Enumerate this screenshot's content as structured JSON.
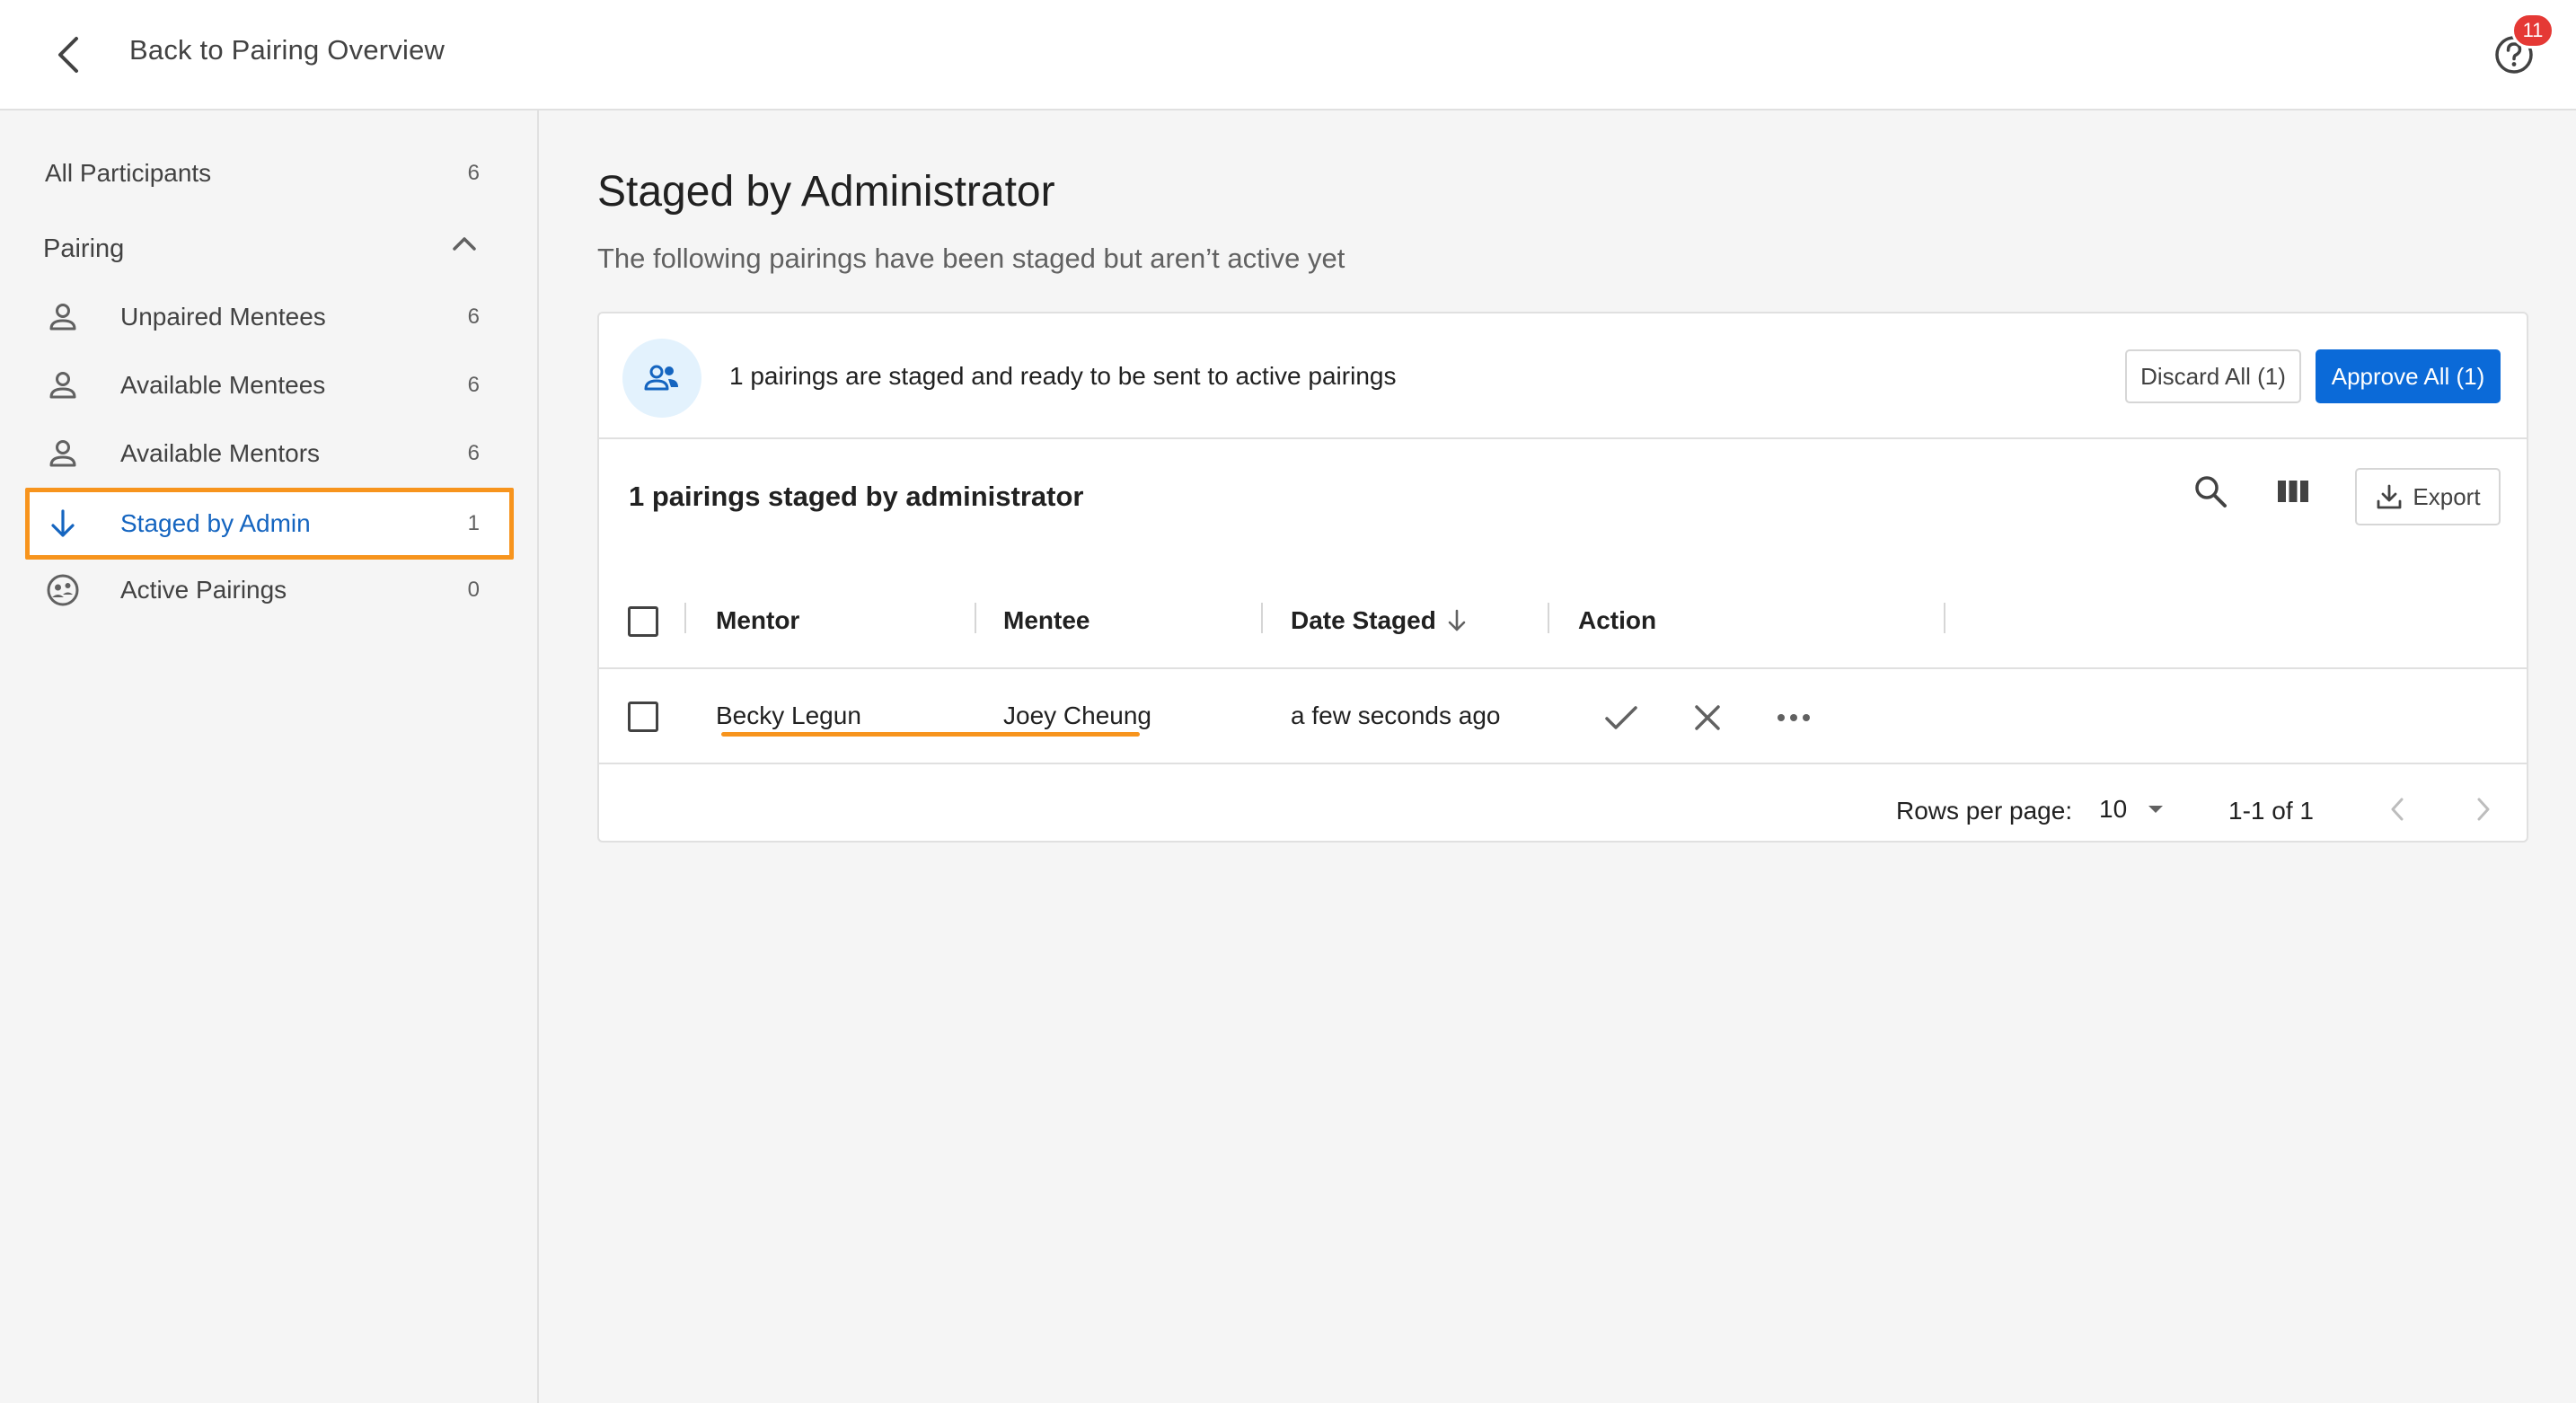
{
  "header": {
    "back_label": "Back to Pairing Overview",
    "help_badge_count": "11"
  },
  "sidebar": {
    "all_participants": {
      "label": "All Participants",
      "count": "6"
    },
    "section": {
      "label": "Pairing"
    },
    "items": [
      {
        "label": "Unpaired Mentees",
        "count": "6",
        "icon": "person-icon"
      },
      {
        "label": "Available Mentees",
        "count": "6",
        "icon": "person-icon"
      },
      {
        "label": "Available Mentors",
        "count": "6",
        "icon": "person-icon"
      },
      {
        "label": "Staged by Admin",
        "count": "1",
        "icon": "arrow-down-icon",
        "active": true
      },
      {
        "label": "Active Pairings",
        "count": "0",
        "icon": "people-circle-icon"
      }
    ]
  },
  "main": {
    "title": "Staged by Administrator",
    "subtitle": "The following pairings have been staged but aren’t active yet",
    "banner": {
      "text": "1 pairings are staged and ready to be sent to active pairings",
      "discard_label": "Discard All (1)",
      "approve_label": "Approve All (1)"
    },
    "table": {
      "title": "1 pairings staged by administrator",
      "export_label": "Export",
      "columns": [
        "Mentor",
        "Mentee",
        "Date Staged",
        "Action"
      ],
      "rows": [
        {
          "mentor": "Becky Legun",
          "mentee": "Joey Cheung",
          "date_staged": "a few seconds ago"
        }
      ],
      "footer": {
        "rows_per_page_label": "Rows per page:",
        "rows_per_page_value": "10",
        "range": "1-1 of 1"
      }
    }
  },
  "colors": {
    "accent_blue": "#0b6ad8",
    "highlight_orange": "#f7941d",
    "badge_red": "#e53935"
  }
}
